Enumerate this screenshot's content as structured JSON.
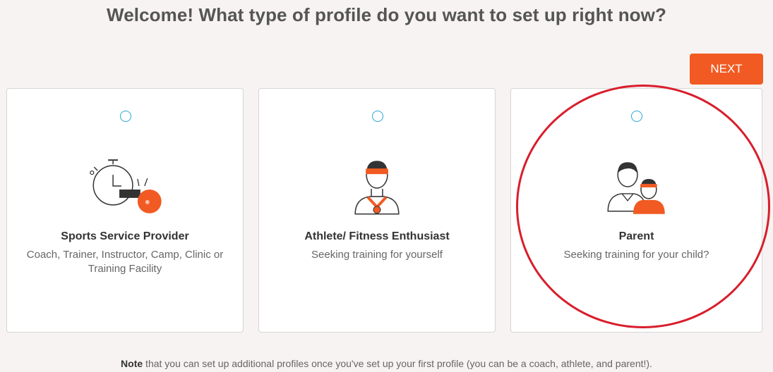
{
  "heading": "Welcome! What type of profile do you want to set up right now?",
  "next_button": "NEXT",
  "cards": [
    {
      "title": "Sports Service Provider",
      "description": "Coach, Trainer, Instructor, Camp, Clinic or Training Facility",
      "icon": "stopwatch-whistle-icon",
      "selected": false
    },
    {
      "title": "Athlete/ Fitness Enthusiast",
      "description": "Seeking training for yourself",
      "icon": "athlete-medal-icon",
      "selected": false
    },
    {
      "title": "Parent",
      "description": "Seeking training for your child?",
      "icon": "parent-child-icon",
      "selected": false
    }
  ],
  "note": {
    "bold": "Note",
    "text": " that you can set up additional profiles once you've set up your first profile (you can be a coach, athlete, and parent!)."
  },
  "colors": {
    "accent": "#f15a22",
    "radio": "#2aa6d6",
    "annotation": "#d81e2c"
  }
}
